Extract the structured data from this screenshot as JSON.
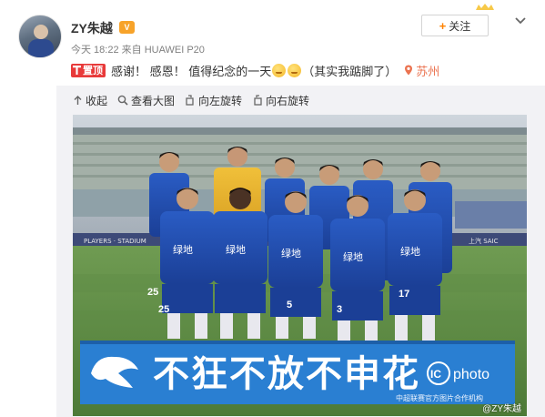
{
  "user": {
    "name": "ZY朱越",
    "meta": "今天 18:22 来自 HUAWEI P20"
  },
  "follow": {
    "label": "关注"
  },
  "post": {
    "badge": "置顶",
    "text_part1": "感谢！ 感恩！  值得纪念的一天",
    "text_part2": "（其实我踮脚了）",
    "location": "苏州"
  },
  "toolbar": {
    "collapse": "收起",
    "view_large": "查看大图",
    "rotate_left": "向左旋转",
    "rotate_right": "向右旋转"
  },
  "photo": {
    "banner": "不狂不放不申花",
    "photo_brand": "photo",
    "credit": "中超联赛官方图片合作机构",
    "watermark": "@ZY朱越",
    "jerseys": [
      "25",
      "25",
      "5",
      "3",
      "17"
    ]
  },
  "colors": {
    "accent": "#ff8200",
    "badge_red": "#e83a3a",
    "location": "#eb7350",
    "jersey_blue": "#1f4fb4"
  }
}
